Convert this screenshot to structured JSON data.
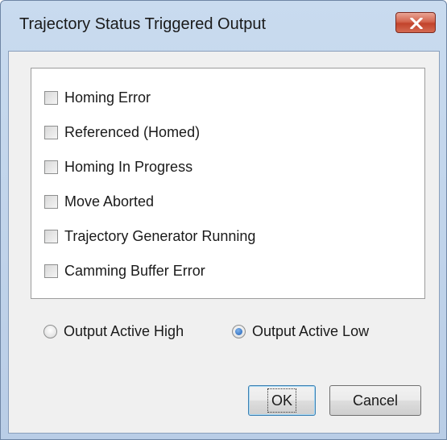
{
  "window": {
    "title": "Trajectory Status Triggered Output"
  },
  "checkboxes": [
    {
      "label": "Homing Error",
      "checked": false
    },
    {
      "label": "Referenced (Homed)",
      "checked": false
    },
    {
      "label": "Homing In Progress",
      "checked": false
    },
    {
      "label": "Move Aborted",
      "checked": false
    },
    {
      "label": "Trajectory Generator Running",
      "checked": false
    },
    {
      "label": "Camming Buffer Error",
      "checked": false
    }
  ],
  "output_mode": {
    "options": [
      {
        "label": "Output Active High",
        "selected": false
      },
      {
        "label": "Output Active Low",
        "selected": true
      }
    ]
  },
  "buttons": {
    "ok_label": "OK",
    "cancel_label": "Cancel"
  },
  "icons": {
    "close": "close-x-icon"
  }
}
